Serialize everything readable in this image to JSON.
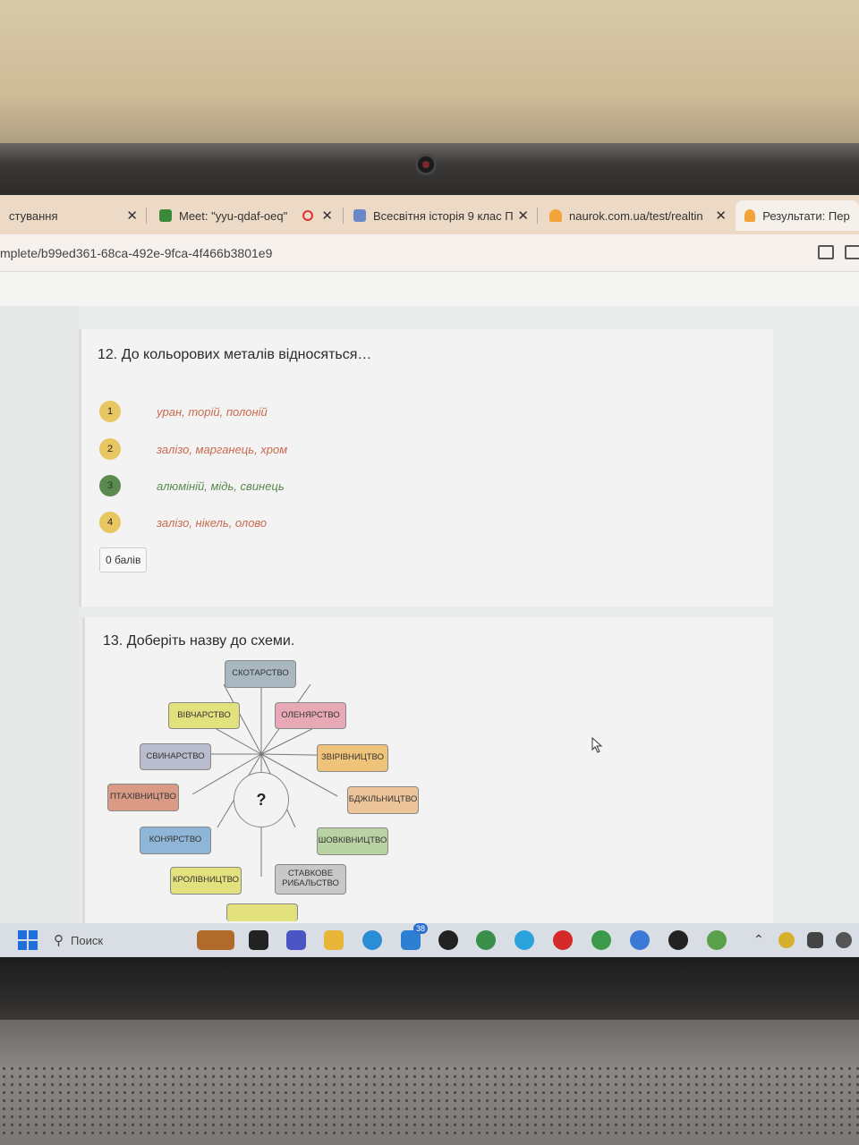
{
  "tabs": [
    {
      "title": "стування",
      "close": "✕"
    },
    {
      "title": "Meet: \"yyu-qdaf-oeq\"",
      "close": "✕"
    },
    {
      "title": "Всесвітня історія 9 клас П",
      "close": "✕"
    },
    {
      "title": "naurok.com.ua/test/realtin",
      "close": "✕"
    },
    {
      "title": "Результати: Перви",
      "close": ""
    }
  ],
  "url": "mplete/b99ed361-68ca-492e-9fca-4f466b3801e9",
  "question12": {
    "title": "12. До кольорових металів відносяться…",
    "options": [
      {
        "num": "1",
        "text": "уран, торій, полоній",
        "correct": false
      },
      {
        "num": "2",
        "text": "залізо, марганець, хром",
        "correct": false
      },
      {
        "num": "3",
        "text": "алюміній, мідь, свинець",
        "correct": true
      },
      {
        "num": "4",
        "text": "залізо, нікель, олово",
        "correct": false
      }
    ],
    "score": "0 балів"
  },
  "question13": {
    "title": "13. Доберіть назву до схеми.",
    "center": "?",
    "nodes": {
      "skotarstvo": "СКОТАРСТВО",
      "vivcharstvo": "ВІВЧАРСТВО",
      "olenyarstvo": "ОЛЕНЯРСТВО",
      "svynarstvo": "СВИНАРСТВО",
      "zvirivnytstvo": "ЗВІРІВНИЦТВО",
      "ptakhivnytstvo": "ПТАХІВНИЦТВО",
      "bdzhilnytstvo": "БДЖІЛЬНИЦТВО",
      "konyarstvo": "КОНЯРСТВО",
      "shovkivnytstvo": "ШОВКІВНИЦТВО",
      "krolivnytstvo": "КРОЛІВНИЦТВО",
      "stavkove1": "СТАВКОВЕ",
      "stavkove2": "РИБАЛЬСТВО"
    },
    "colors": {
      "grayblue": "#a9b8c0",
      "yellow": "#e3e07e",
      "pink": "#e8a9b6",
      "lavender": "#b9bccc",
      "orange": "#efc47a",
      "red": "#d99a86",
      "peach": "#ecc49a",
      "blue": "#8fb6d6",
      "green": "#b9d3a4",
      "gray": "#c8c8c8"
    }
  },
  "taskbar": {
    "search_label": "Поиск",
    "badge_count": "38"
  }
}
